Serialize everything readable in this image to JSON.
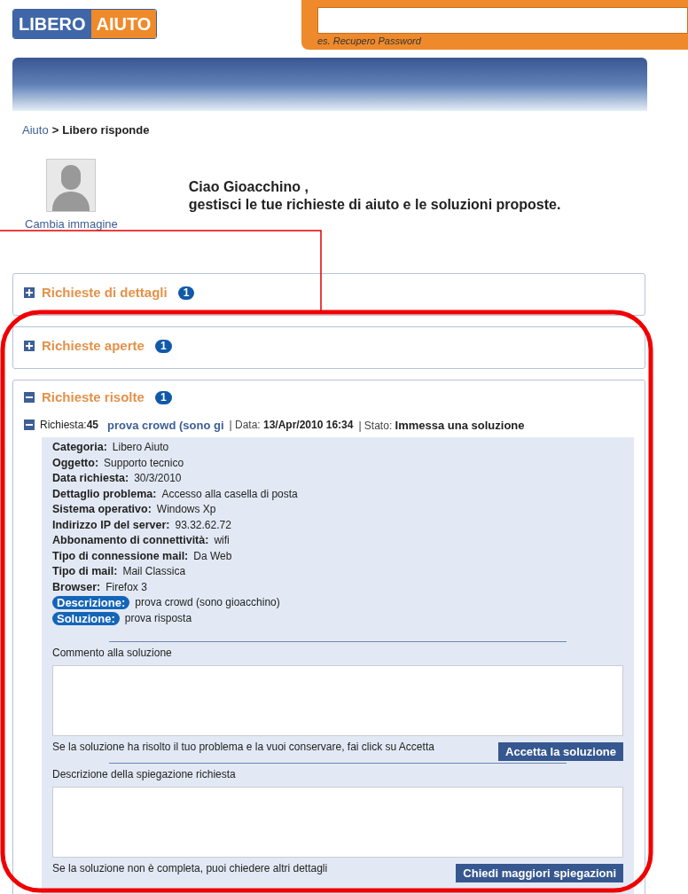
{
  "header": {
    "logo": [
      "LIBERO",
      "AIUTO"
    ],
    "search": {
      "hint": "es. Recupero Password"
    }
  },
  "breadcrumb": {
    "link": "Aiuto",
    "separator": ">",
    "current": "Libero risponde"
  },
  "profile": {
    "change_image": "Cambia immagine",
    "greeting": "Ciao Gioacchino ,",
    "subtitle": "gestisci le tue richieste di aiuto e le soluzioni proposte."
  },
  "sections": [
    {
      "title": "Richieste di dettagli",
      "count": "1",
      "expanded": false
    },
    {
      "title": "Richieste aperte",
      "count": "1",
      "expanded": false
    },
    {
      "title": "Richieste risolte",
      "count": "1",
      "expanded": true
    }
  ],
  "request": {
    "expanded": true,
    "id_label": "Richiesta:",
    "id": "45",
    "subject": "prova crowd (sono gi",
    "date_label": "| Data:",
    "date": "13/Apr/2010 16:34",
    "status_label": "| Stato:",
    "status": "Immessa una soluzione",
    "fields": [
      {
        "kind": "field",
        "label": "Categoria:",
        "value": "Libero Aiuto"
      },
      {
        "kind": "field",
        "label": "Oggetto:",
        "value": "Supporto tecnico"
      },
      {
        "kind": "field",
        "label": "Data richiesta:",
        "value": "30/3/2010"
      },
      {
        "kind": "field",
        "label": "Dettaglio problema:",
        "value": "Accesso alla casella di posta"
      },
      {
        "kind": "field",
        "label": "Sistema operativo:",
        "value": "Windows Xp"
      },
      {
        "kind": "field",
        "label": "Indirizzo IP del server:",
        "value": "93.32.62.72"
      },
      {
        "kind": "field",
        "label": "Abbonamento di connettività:",
        "value": "wifi"
      },
      {
        "kind": "field",
        "label": "Tipo di connessione mail:",
        "value": "Da Web"
      },
      {
        "kind": "field",
        "label": "Tipo di mail:",
        "value": "Mail Classica"
      },
      {
        "kind": "field",
        "label": "Browser:",
        "value": "Firefox 3"
      },
      {
        "kind": "tag",
        "label": "Descrizione:",
        "value": "prova crowd (sono gioacchino)"
      },
      {
        "kind": "tag",
        "label": "Soluzione:",
        "value": "prova risposta"
      }
    ],
    "forms": [
      {
        "label": "Commento alla soluzione",
        "hint": "Se la soluzione ha risolto il tuo problema e la vuoi conservare, fai click su Accetta",
        "button": "Accetta la soluzione"
      },
      {
        "label": "Descrizione della spiegazione richiesta",
        "hint": "Se la soluzione non è completa, puoi chiedere altri dettagli",
        "button": "Chiedi maggiori spiegazioni"
      }
    ]
  }
}
